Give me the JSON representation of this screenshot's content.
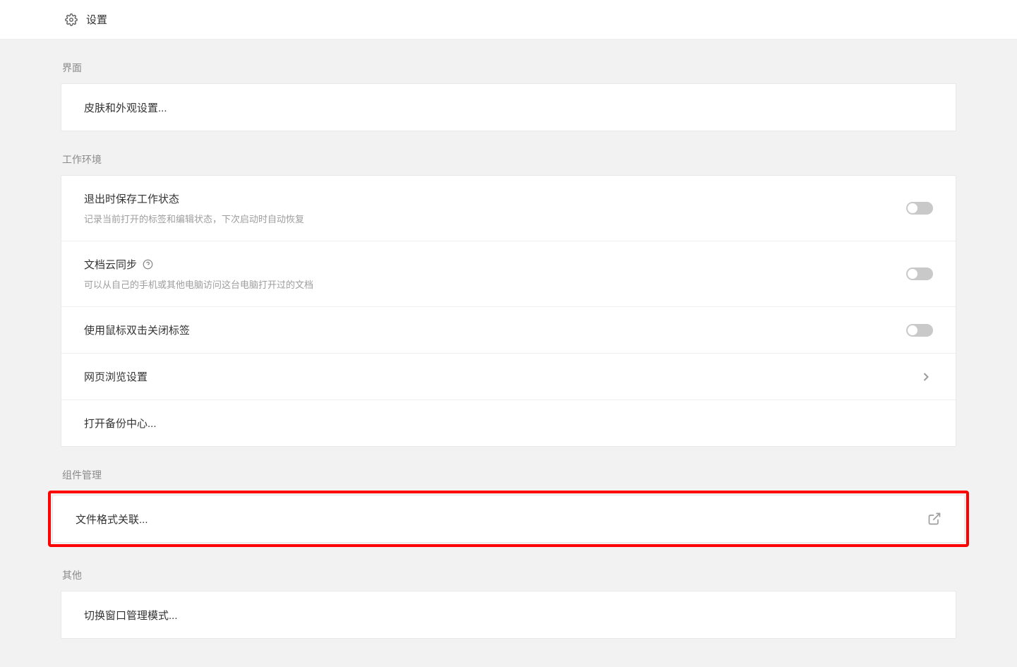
{
  "header": {
    "title": "设置"
  },
  "sections": {
    "interface": {
      "label": "界面",
      "skin": "皮肤和外观设置..."
    },
    "workenv": {
      "label": "工作环境",
      "saveState": {
        "title": "退出时保存工作状态",
        "desc": "记录当前打开的标签和编辑状态，下次启动时自动恢复"
      },
      "cloudSync": {
        "title": "文档云同步",
        "desc": "可以从自己的手机或其他电脑访问这台电脑打开过的文档"
      },
      "doubleClick": "使用鼠标双击关闭标签",
      "webBrowse": "网页浏览设置",
      "backup": "打开备份中心..."
    },
    "components": {
      "label": "组件管理",
      "fileFormat": "文件格式关联..."
    },
    "other": {
      "label": "其他",
      "windowMode": "切换窗口管理模式..."
    }
  }
}
